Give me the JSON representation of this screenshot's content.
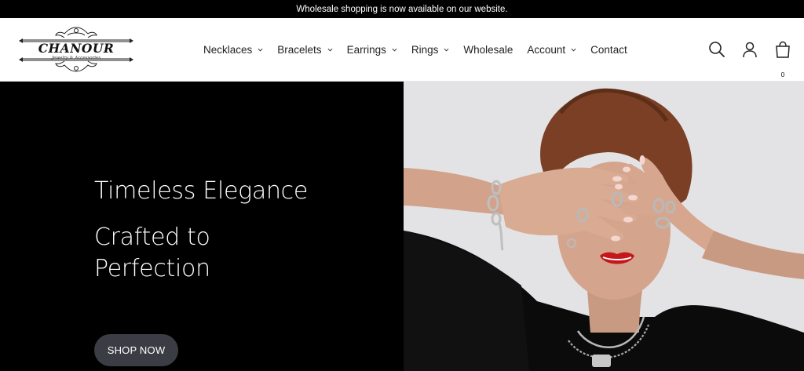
{
  "announcement": "Wholesale shopping is now available on our website.",
  "logo": {
    "name": "CHANOUR",
    "tagline": "Jewelry & Accessories"
  },
  "nav": {
    "items": [
      {
        "label": "Necklaces",
        "has_dropdown": true
      },
      {
        "label": "Bracelets",
        "has_dropdown": true
      },
      {
        "label": "Earrings",
        "has_dropdown": true
      },
      {
        "label": "Rings",
        "has_dropdown": true
      },
      {
        "label": "Wholesale",
        "has_dropdown": false
      },
      {
        "label": "Account",
        "has_dropdown": true
      },
      {
        "label": "Contact",
        "has_dropdown": false
      }
    ]
  },
  "header_icons": {
    "search": "search-icon",
    "account": "user-icon",
    "cart": "bag-icon",
    "cart_count": "0"
  },
  "hero": {
    "title": "Timeless Elegance",
    "subtitle": "Crafted to Perfection",
    "button_label": "SHOP NOW",
    "image": "model-covering-eyes-with-ringed-hands"
  },
  "colors": {
    "announce_bg": "#000000",
    "hero_left_bg": "#000000",
    "button_bg": "#3a3d44",
    "photo_bg": "#e3e3e5",
    "lips": "#c4161c"
  }
}
